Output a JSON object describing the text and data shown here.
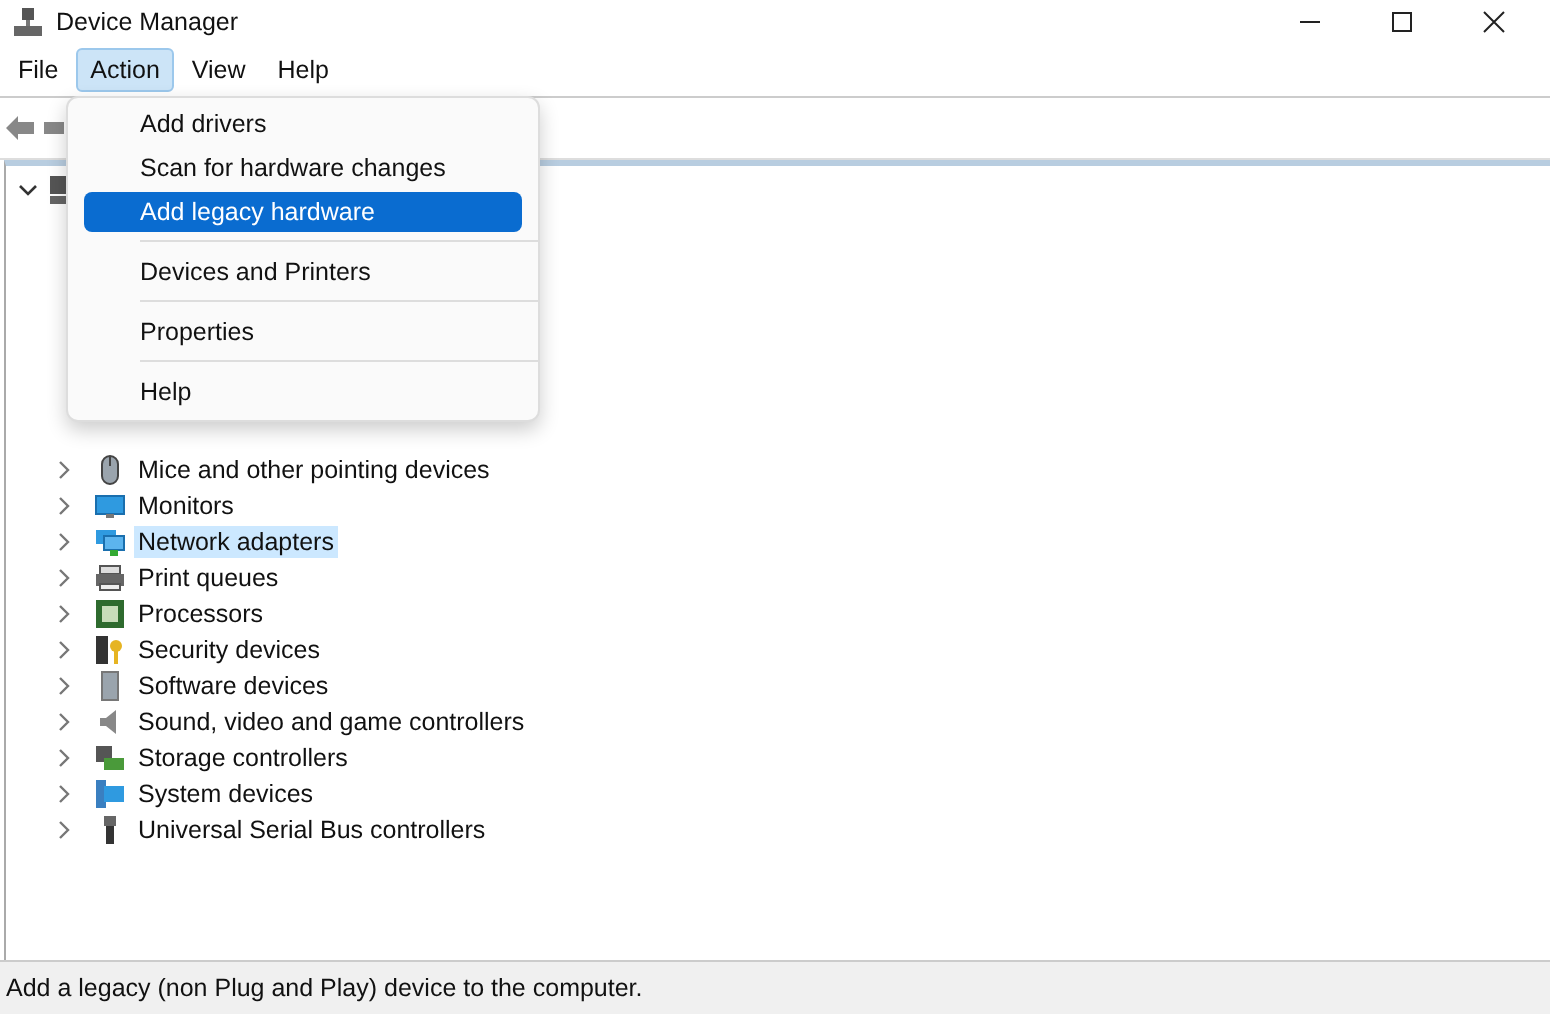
{
  "window": {
    "title": "Device Manager"
  },
  "menu_bar": [
    {
      "label": "File",
      "selected": false
    },
    {
      "label": "Action",
      "selected": true
    },
    {
      "label": "View",
      "selected": false
    },
    {
      "label": "Help",
      "selected": false
    }
  ],
  "action_menu": [
    {
      "label": "Add drivers",
      "selected": false,
      "separator_after": false
    },
    {
      "label": "Scan for hardware changes",
      "selected": false,
      "separator_after": false
    },
    {
      "label": "Add legacy hardware",
      "selected": true,
      "separator_after": true
    },
    {
      "label": "Devices and Printers",
      "selected": false,
      "separator_after": true
    },
    {
      "label": "Properties",
      "selected": false,
      "separator_after": true
    },
    {
      "label": "Help",
      "selected": false,
      "separator_after": false
    }
  ],
  "tree": {
    "root": {
      "expanded": true
    },
    "items": [
      {
        "label": "Mice and other pointing devices",
        "selected": false,
        "expanded": false
      },
      {
        "label": "Monitors",
        "selected": false,
        "expanded": false
      },
      {
        "label": "Network adapters",
        "selected": true,
        "expanded": false
      },
      {
        "label": "Print queues",
        "selected": false,
        "expanded": false
      },
      {
        "label": "Processors",
        "selected": false,
        "expanded": false
      },
      {
        "label": "Security devices",
        "selected": false,
        "expanded": false
      },
      {
        "label": "Software devices",
        "selected": false,
        "expanded": false
      },
      {
        "label": "Sound, video and game controllers",
        "selected": false,
        "expanded": false
      },
      {
        "label": "Storage controllers",
        "selected": false,
        "expanded": false
      },
      {
        "label": "System devices",
        "selected": false,
        "expanded": false
      },
      {
        "label": "Universal Serial Bus controllers",
        "selected": false,
        "expanded": false
      }
    ]
  },
  "status_bar": {
    "text": "Add a legacy (non Plug and Play) device to the computer."
  }
}
